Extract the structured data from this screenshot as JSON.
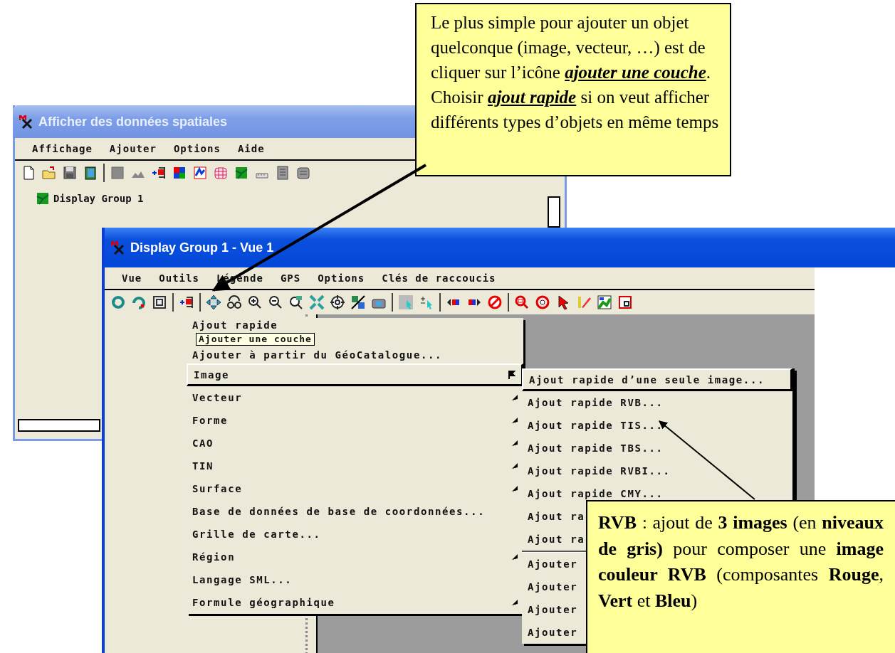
{
  "windows": [
    {
      "title": "Afficher des données spatiales",
      "active": false,
      "menu": [
        {
          "label": "Affichage"
        },
        {
          "label": "Ajouter"
        },
        {
          "label": "Options"
        },
        {
          "label": "Aide"
        }
      ],
      "tree": [
        {
          "label": "Display Group 1"
        }
      ]
    },
    {
      "title": "Display Group 1 - Vue 1",
      "active": true,
      "menu": [
        {
          "label": "Vue"
        },
        {
          "label": "Outils"
        },
        {
          "label": "Légende"
        },
        {
          "label": "GPS"
        },
        {
          "label": "Options"
        },
        {
          "label": "Clés de raccoucis"
        }
      ]
    }
  ],
  "add_menu": {
    "items": [
      {
        "label": "Ajout rapide",
        "kind": "command",
        "selected": false
      },
      {
        "label": "Ajouter à partir du GéoCatalogue...",
        "kind": "command",
        "selected": false
      },
      {
        "label": "Image",
        "kind": "submenu",
        "selected": true
      },
      {
        "label": "Vecteur",
        "kind": "submenu",
        "selected": false
      },
      {
        "label": "Forme",
        "kind": "submenu",
        "selected": false
      },
      {
        "label": "CAO",
        "kind": "submenu",
        "selected": false
      },
      {
        "label": "TIN",
        "kind": "submenu",
        "selected": false
      },
      {
        "label": "Surface",
        "kind": "submenu",
        "selected": false
      },
      {
        "label": "Base de données de base de coordonnées...",
        "kind": "command",
        "selected": false
      },
      {
        "label": "Grille de carte...",
        "kind": "command",
        "selected": false
      },
      {
        "label": "Région",
        "kind": "submenu",
        "selected": false
      },
      {
        "label": "Langage SML...",
        "kind": "command",
        "selected": false
      },
      {
        "label": "Formule géographique",
        "kind": "submenu",
        "selected": false
      }
    ]
  },
  "tooltip": {
    "text": "Ajouter une couche"
  },
  "image_submenu": {
    "items": [
      {
        "label": "Ajout rapide d’une seule image...",
        "kind": "command",
        "selected": true
      },
      {
        "label": "Ajout rapide RVB...",
        "kind": "command",
        "selected": false
      },
      {
        "label": "Ajout rapide TIS...",
        "kind": "command",
        "selected": false
      },
      {
        "label": "Ajout rapide TBS...",
        "kind": "command",
        "selected": false
      },
      {
        "label": "Ajout rapide RVBI...",
        "kind": "command",
        "selected": false
      },
      {
        "label": "Ajout rapide CMY...",
        "kind": "command",
        "selected": false
      },
      {
        "label": "Ajout ra",
        "kind": "command",
        "selected": false
      },
      {
        "label": "Ajout ra",
        "kind": "command",
        "selected": false
      },
      {
        "kind": "separator"
      },
      {
        "label": "Ajouter",
        "kind": "command",
        "selected": false
      },
      {
        "label": "Ajouter",
        "kind": "command",
        "selected": false
      },
      {
        "label": "Ajouter",
        "kind": "command",
        "selected": false
      },
      {
        "label": "Ajouter",
        "kind": "command",
        "selected": false
      }
    ]
  },
  "callouts": [
    {
      "text": "Le plus simple pour ajouter un objet quelconque (image, vecteur, …) est de cliquer sur l’icône *ajouter une couche*. Choisir *ajout rapide* si on veut afficher différents types d’objets en même temps"
    },
    {
      "text": "**RVB** : ajout de **3 images** (en **niveaux de gris)** pour composer une **image couleur RVB** (composantes **Rouge**, **Vert** et **Bleu**)"
    }
  ]
}
